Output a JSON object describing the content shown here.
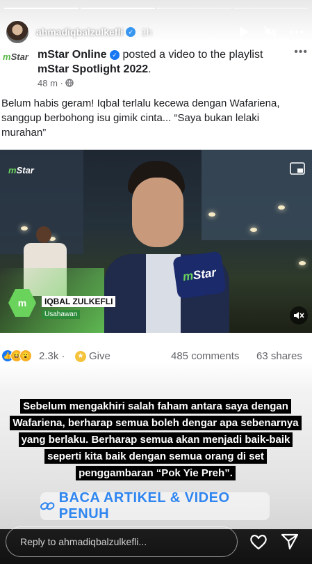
{
  "story": {
    "progress_segments": [
      1,
      1,
      0.02,
      0
    ],
    "username": "ahmadiqbalzulkefli",
    "time": "1h",
    "reply_placeholder": "Reply to ahmadiqbalzulkefli...",
    "overlay_text": "Sebelum mengakhiri salah faham antara saya dengan Wafariena, berharap semua boleh dengar apa sebenarnya yang berlaku. Berharap semua akan menjadi baik-baik seperti kita baik dengan semua orang di set penggambaran “Pok Yie Preh”.",
    "link_label": "BACA ARTIKEL & VIDEO PENUH"
  },
  "post": {
    "page_logo": "Star",
    "page_logo_prefix": "m",
    "page_name": "mStar Online",
    "action_text": "posted a video to the playlist",
    "playlist": "mStar Spotlight 2022",
    "playlist_suffix": ".",
    "meta": "48 m ·",
    "more": "•••",
    "caption": "Belum habis geram! Iqbal terlalu kecewa dengan Wafariena, sanggup berbohong isu gimik cinta... “Saya bukan lelaki murahan”",
    "video": {
      "watermark_prefix": "m",
      "watermark": "Star",
      "name": "IQBAL ZULKEFLI",
      "role": "Usahawan",
      "mic_prefix": "m",
      "mic_label": "Star"
    },
    "reaction_count": "2.3k",
    "dot": "·",
    "give_label": "Give",
    "comments": "485 comments",
    "shares": "63 shares"
  },
  "colors": {
    "link": "#2f86f0",
    "verified": "#3897f0",
    "mstar_green": "#6ad35c"
  }
}
